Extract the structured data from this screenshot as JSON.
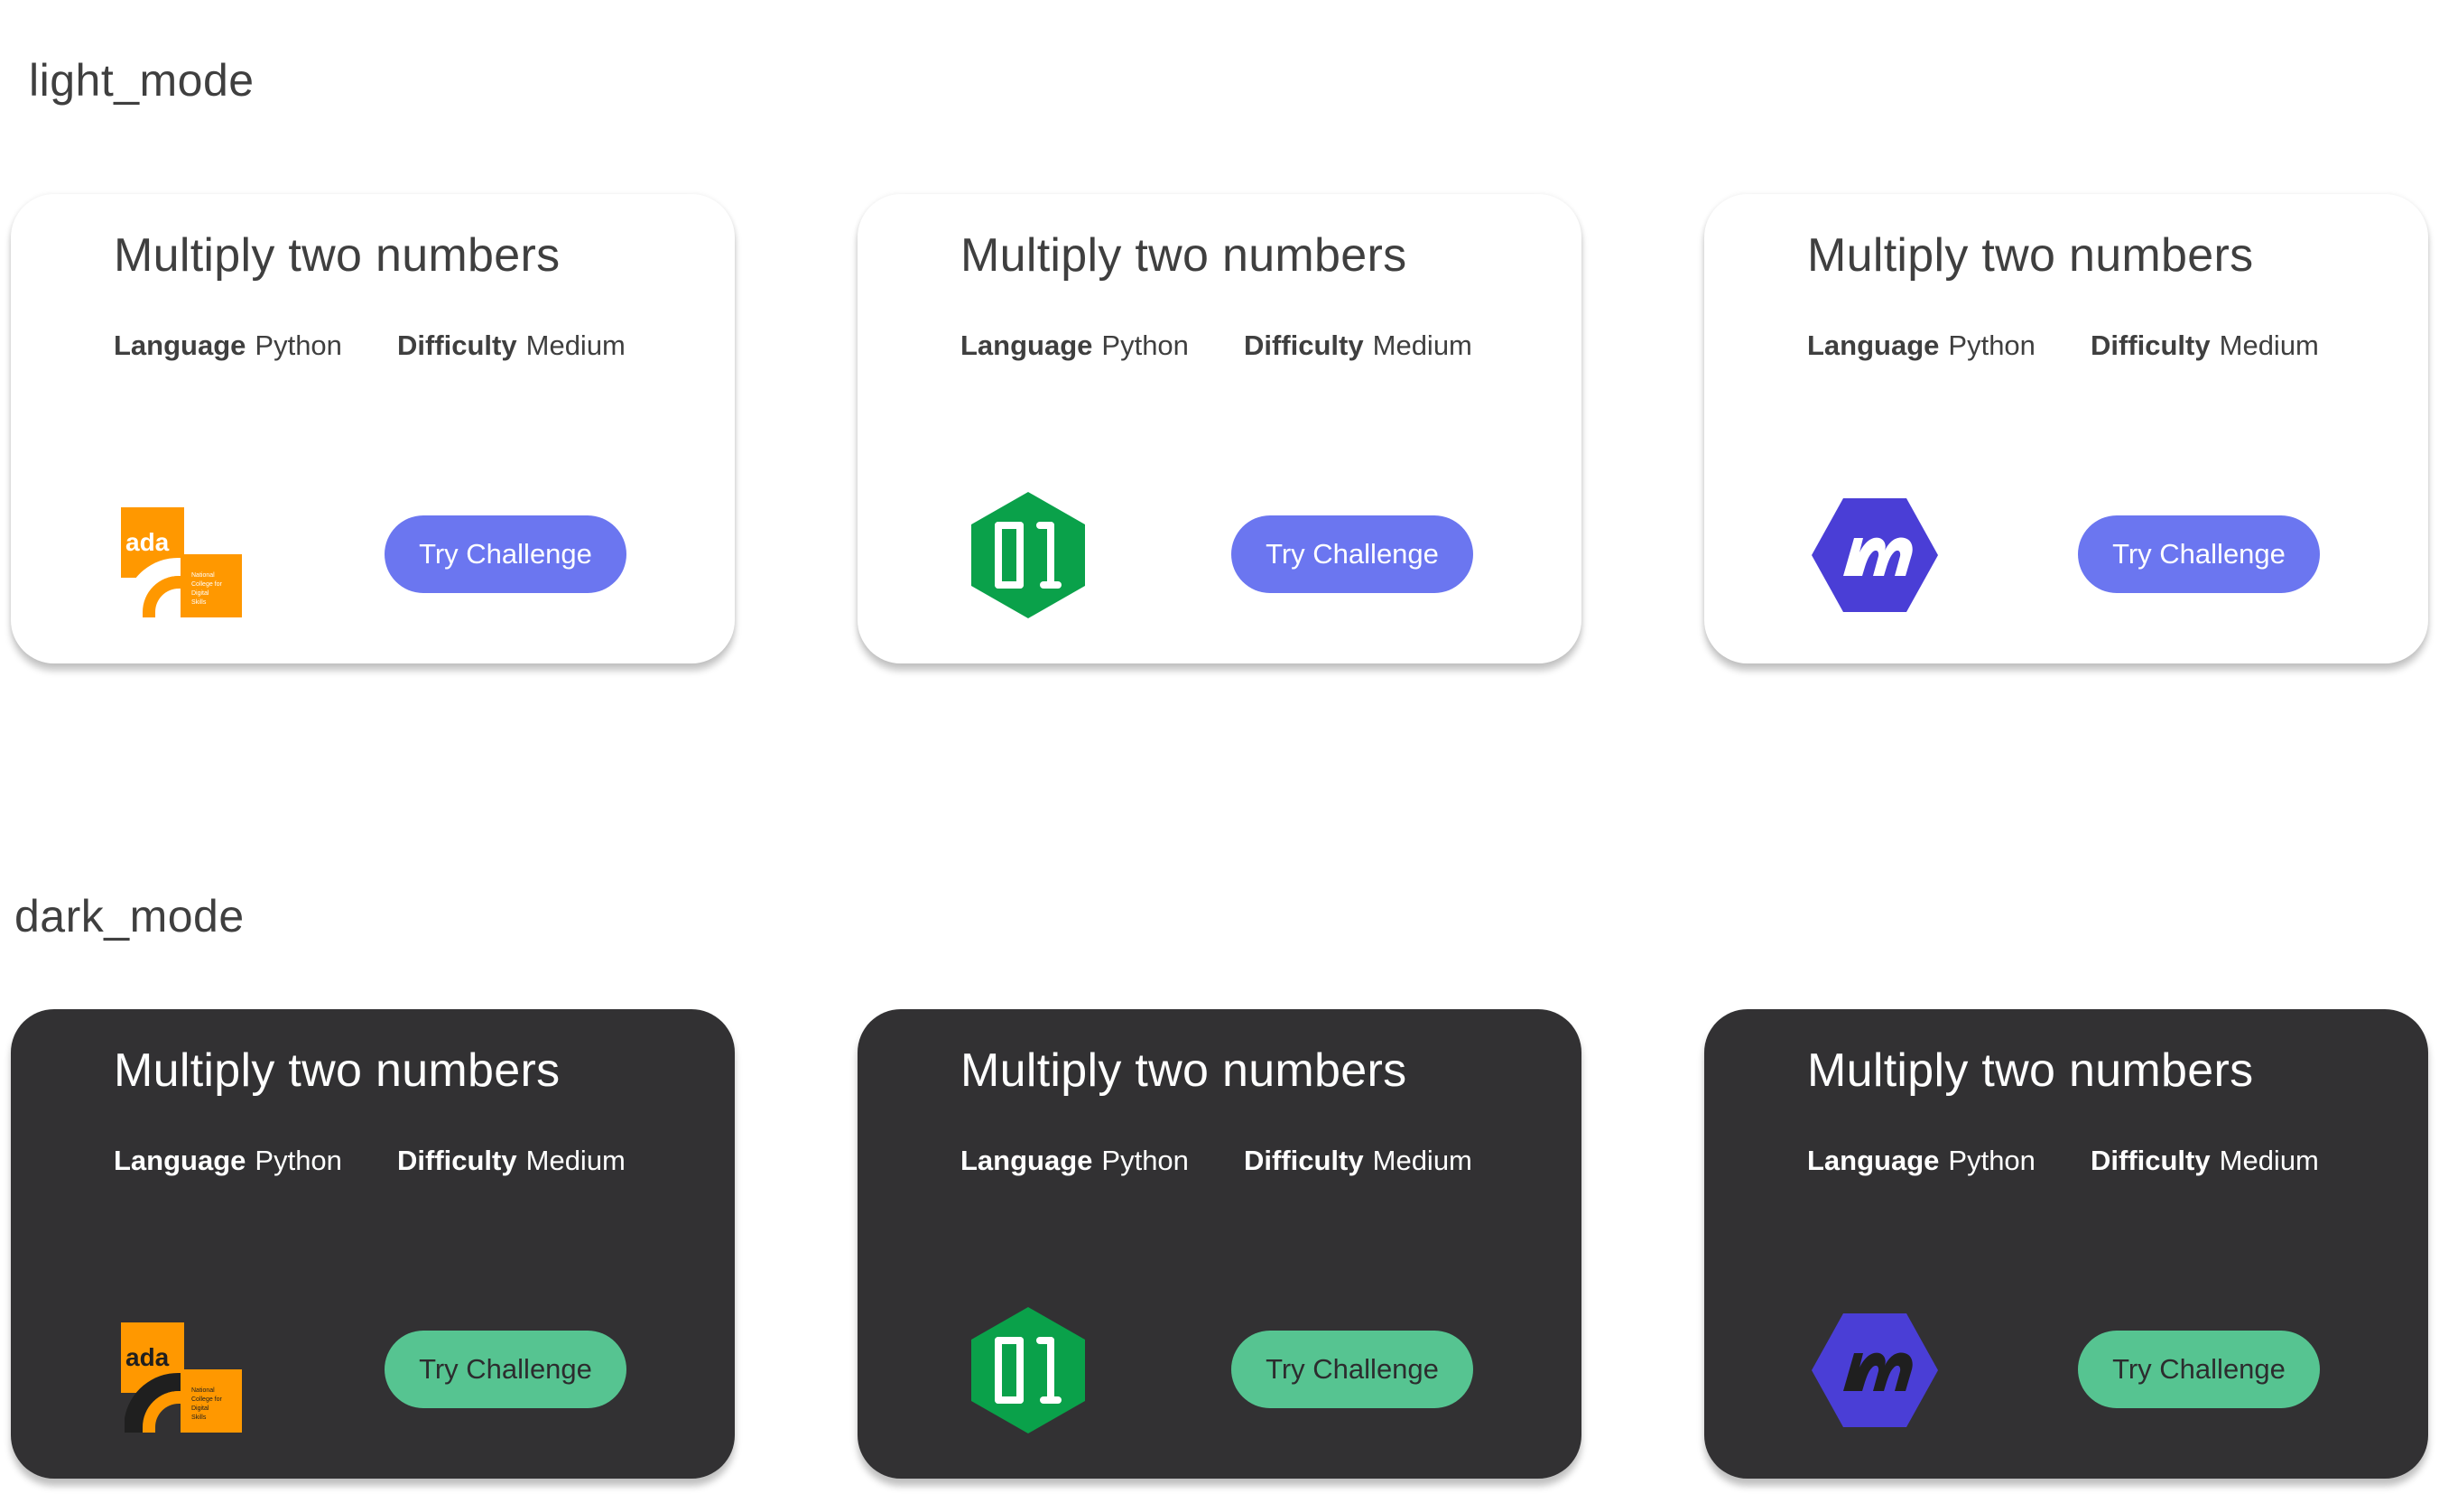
{
  "sections": {
    "light": {
      "label": "light_mode"
    },
    "dark": {
      "label": "dark_mode"
    }
  },
  "theme_colors": {
    "light_card_bg": "#ffffff",
    "dark_card_bg": "#323133",
    "light_button": "#6b76f0",
    "dark_button": "#56c491",
    "ada_orange": "#ff9800",
    "hex_green": "#0aa14a",
    "hex_purple": "#4a3ed6"
  },
  "cards": {
    "light": [
      {
        "title": "Multiply two numbers",
        "language_label": "Language",
        "language_value": "Python",
        "difficulty_label": "Difficulty",
        "difficulty_value": "Medium",
        "logo": "ada-logo",
        "logo_text": "ada",
        "logo_subtext": "National College for Digital Skills",
        "button_label": "Try Challenge"
      },
      {
        "title": "Multiply two numbers",
        "language_label": "Language",
        "language_value": "Python",
        "difficulty_label": "Difficulty",
        "difficulty_value": "Medium",
        "logo": "green-hexagon-01-logo",
        "button_label": "Try Challenge"
      },
      {
        "title": "Multiply two numbers",
        "language_label": "Language",
        "language_value": "Python",
        "difficulty_label": "Difficulty",
        "difficulty_value": "Medium",
        "logo": "purple-hexagon-m-logo",
        "button_label": "Try Challenge"
      }
    ],
    "dark": [
      {
        "title": "Multiply two numbers",
        "language_label": "Language",
        "language_value": "Python",
        "difficulty_label": "Difficulty",
        "difficulty_value": "Medium",
        "logo": "ada-logo",
        "logo_text": "ada",
        "logo_subtext": "National College for Digital Skills",
        "button_label": "Try Challenge"
      },
      {
        "title": "Multiply two numbers",
        "language_label": "Language",
        "language_value": "Python",
        "difficulty_label": "Difficulty",
        "difficulty_value": "Medium",
        "logo": "green-hexagon-01-logo",
        "button_label": "Try Challenge"
      },
      {
        "title": "Multiply two numbers",
        "language_label": "Language",
        "language_value": "Python",
        "difficulty_label": "Difficulty",
        "difficulty_value": "Medium",
        "logo": "purple-hexagon-m-logo",
        "button_label": "Try Challenge"
      }
    ]
  }
}
